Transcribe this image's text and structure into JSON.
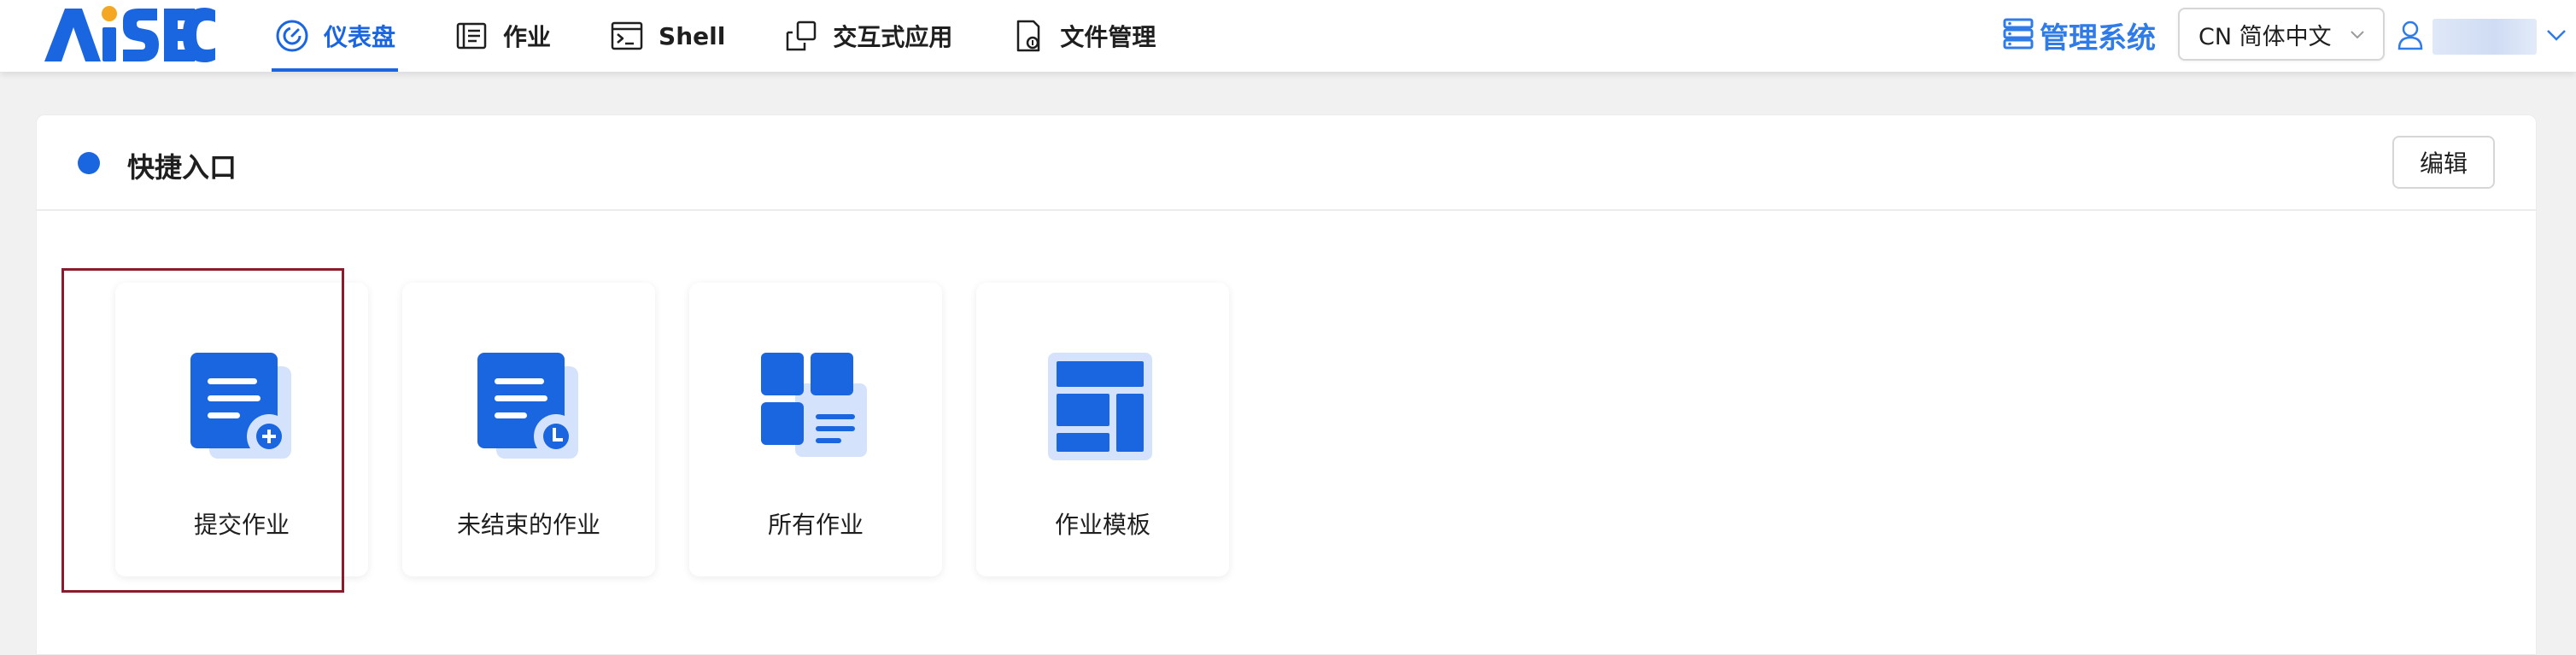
{
  "app": {
    "logo_text": "AiSEC"
  },
  "nav": {
    "items": [
      {
        "label": "仪表盘",
        "icon": "dashboard-icon",
        "active": true
      },
      {
        "label": "作业",
        "icon": "job-list-icon",
        "active": false
      },
      {
        "label": "Shell",
        "icon": "terminal-icon",
        "active": false
      },
      {
        "label": "交互式应用",
        "icon": "interactive-app-icon",
        "active": false
      },
      {
        "label": "文件管理",
        "icon": "file-manager-icon",
        "active": false
      }
    ]
  },
  "header_right": {
    "admin_label": "管理系统",
    "admin_icon": "server-icon",
    "language_value": "CN 简体中文",
    "user_icon": "user-icon"
  },
  "quick_access": {
    "title": "快捷入口",
    "edit_label": "编辑",
    "tiles": [
      {
        "label": "提交作业",
        "icon": "submit-job-icon",
        "selected": true
      },
      {
        "label": "未结束的作业",
        "icon": "unfinished-jobs-icon",
        "selected": false
      },
      {
        "label": "所有作业",
        "icon": "all-jobs-icon",
        "selected": false
      },
      {
        "label": "作业模板",
        "icon": "job-template-icon",
        "selected": false
      }
    ]
  },
  "colors": {
    "accent": "#1a66e0",
    "accent_light": "#d4e3fb",
    "admin_text": "#2f7be8",
    "selection_frame": "#8a1b2c",
    "logo_orange": "#f5a623"
  }
}
